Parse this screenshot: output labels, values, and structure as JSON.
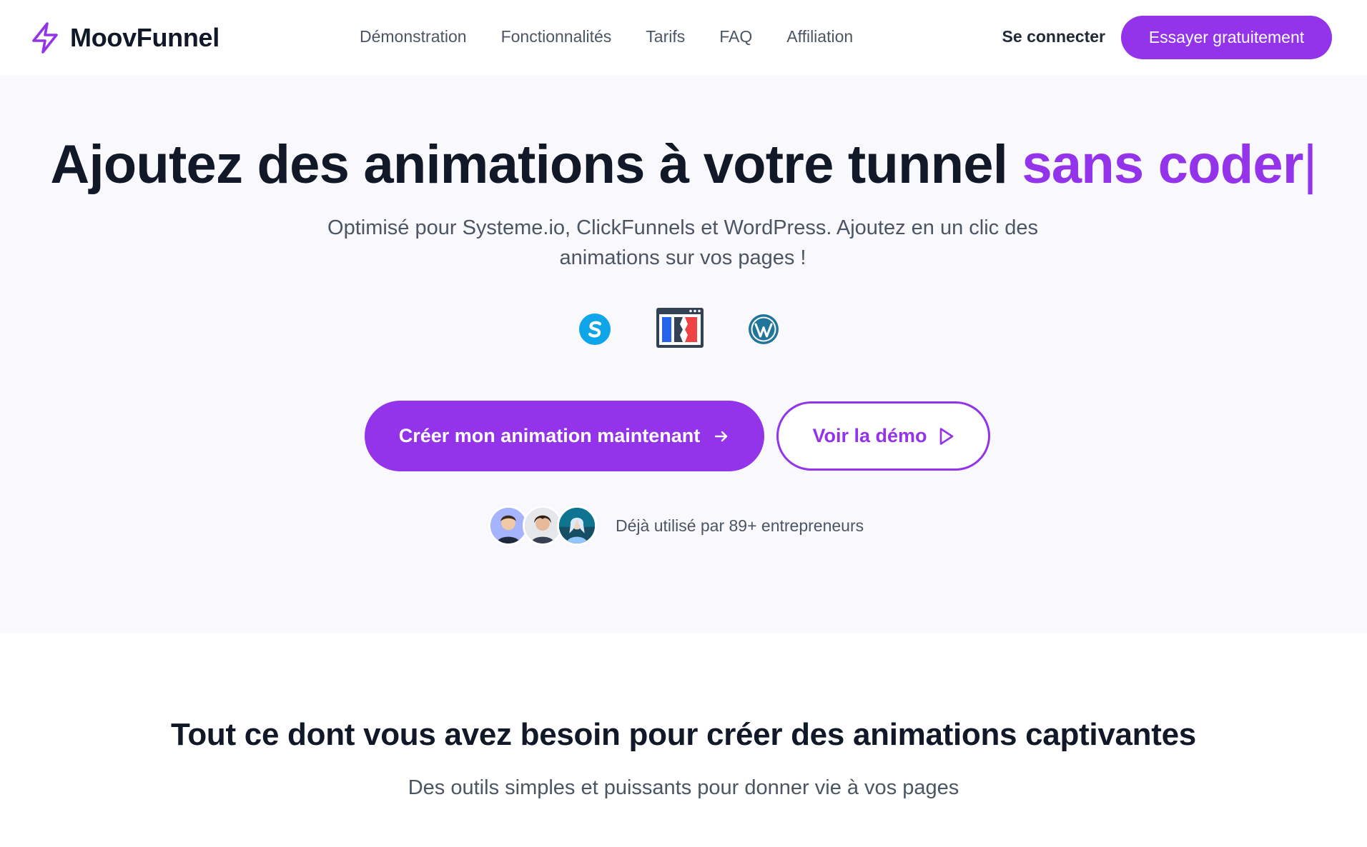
{
  "brand": {
    "name": "MoovFunnel",
    "icon": "lightning-bolt-icon",
    "accent_color": "#9333ea"
  },
  "nav": {
    "links": [
      "Démonstration",
      "Fonctionnalités",
      "Tarifs",
      "FAQ",
      "Affiliation"
    ],
    "login_label": "Se connecter",
    "cta_label": "Essayer gratuitement"
  },
  "hero": {
    "title_main": "Ajoutez des animations à votre tunnel ",
    "title_accent": "sans coder",
    "title_caret": "|",
    "subtitle": "Optimisé pour Systeme.io, ClickFunnels et WordPress. Ajoutez en un clic des animations sur vos pages !",
    "platform_icons": [
      "systeme-io-logo-icon",
      "clickfunnels-logo-icon",
      "wordpress-logo-icon"
    ],
    "cta_primary_label": "Créer mon animation maintenant",
    "cta_secondary_label": "Voir la démo",
    "social_proof_text": "Déjà utilisé par 89+ entrepreneurs"
  },
  "features": {
    "title": "Tout ce dont vous avez besoin pour créer des animations captivantes",
    "subtitle": "Des outils simples et puissants pour donner vie à vos pages"
  },
  "colors": {
    "primary": "#9333ea",
    "heading": "#111827",
    "body_text": "#4b5563",
    "hero_background": "#f9f8fd"
  }
}
